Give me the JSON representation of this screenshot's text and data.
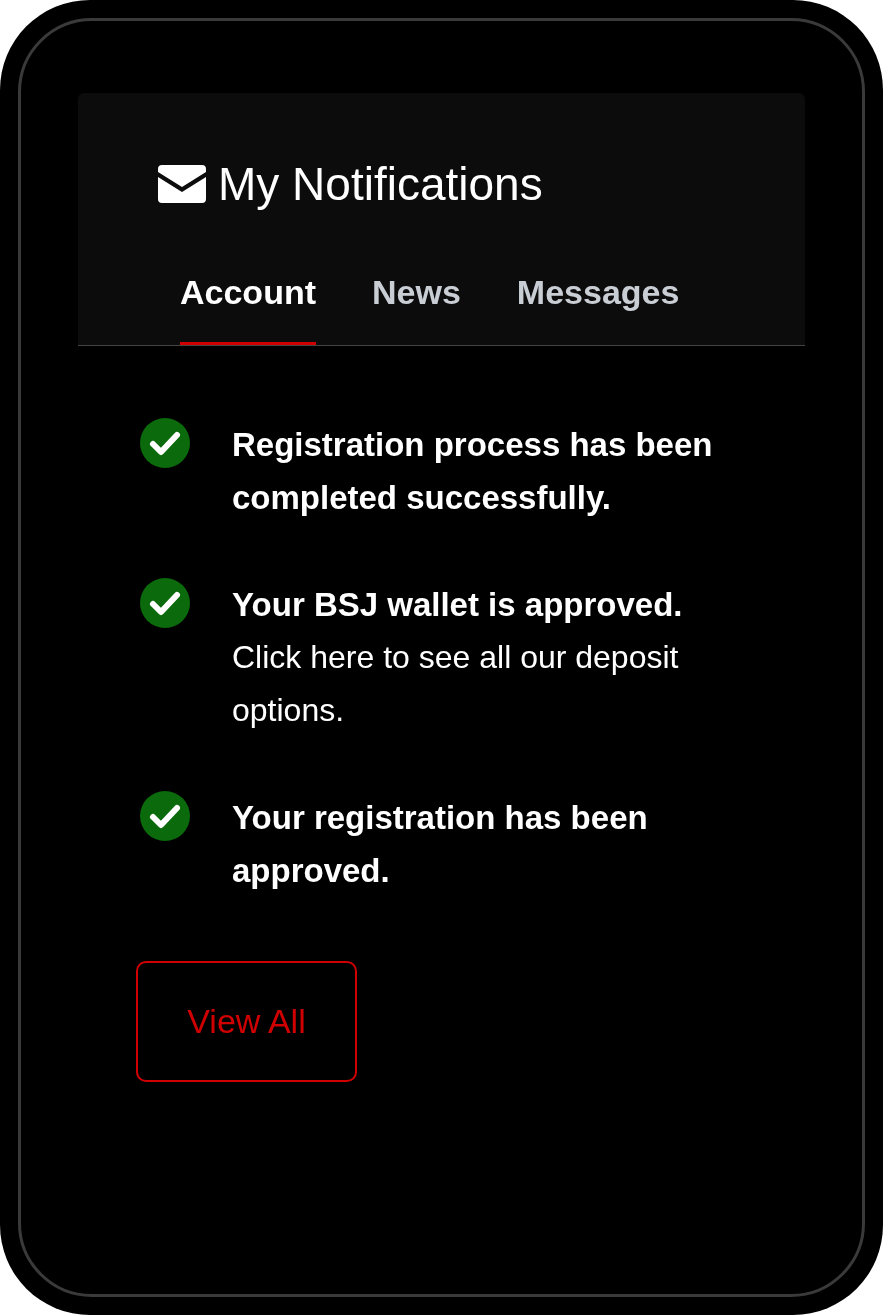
{
  "header": {
    "title": "My Notifications"
  },
  "tabs": [
    {
      "label": "Account",
      "selected": true
    },
    {
      "label": "News",
      "selected": false
    },
    {
      "label": "Messages",
      "selected": false
    }
  ],
  "notifications": [
    {
      "title": "Registration process has been completed successfully."
    },
    {
      "title": "Your BSJ wallet is approved.",
      "detail": "Click here to see all our deposit options."
    },
    {
      "title": "Your registration has been approved."
    }
  ],
  "button": {
    "label": "View All"
  }
}
